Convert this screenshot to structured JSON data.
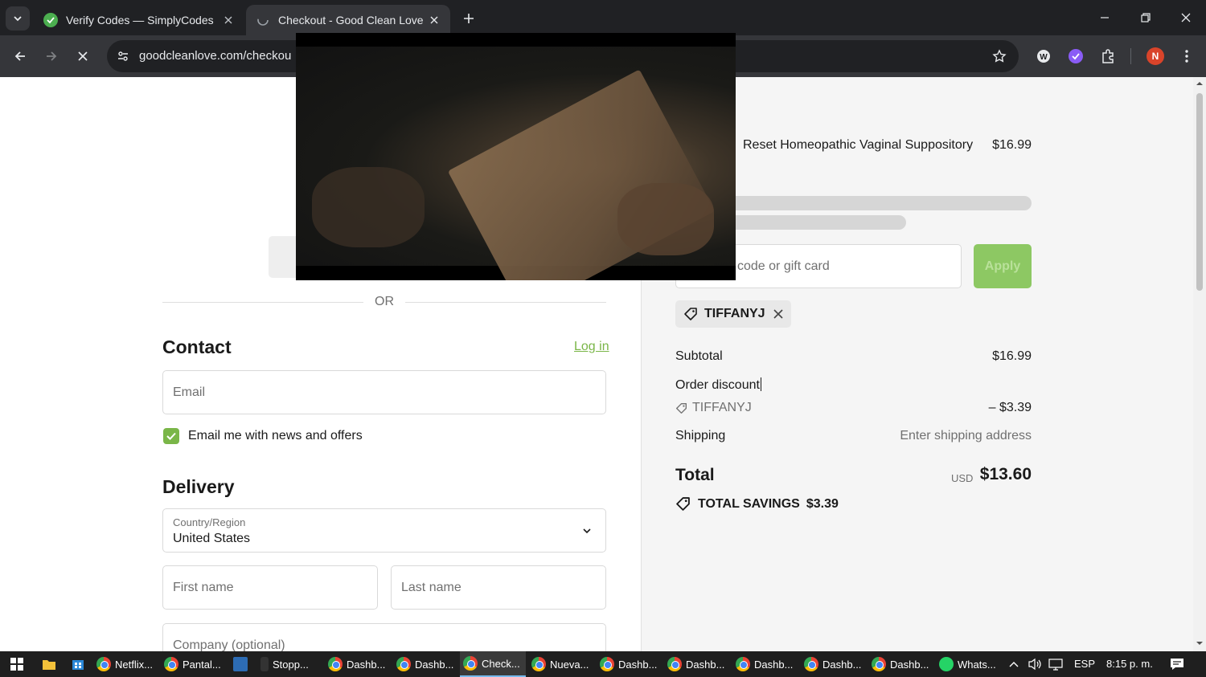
{
  "browser": {
    "tabs": [
      {
        "title": "Verify Codes — SimplyCodes",
        "active": false
      },
      {
        "title": "Checkout - Good Clean Love",
        "active": true
      }
    ],
    "url": "goodcleanlove.com/checkou",
    "profile_initial": "N"
  },
  "checkout": {
    "or_divider": "OR",
    "contact": {
      "heading": "Contact",
      "login_link": "Log in",
      "email_placeholder": "Email",
      "newsletter_label": "Email me with news and offers",
      "newsletter_checked": true
    },
    "delivery": {
      "heading": "Delivery",
      "country_label": "Country/Region",
      "country_value": "United States",
      "first_name_placeholder": "First name",
      "last_name_placeholder": "Last name",
      "company_placeholder": "Company (optional)"
    }
  },
  "summary": {
    "product_name": "Reset Homeopathic Vaginal Suppository",
    "product_price": "$16.99",
    "discount_placeholder": "code or gift card",
    "apply_label": "Apply",
    "applied_code": "TIFFANYJ",
    "subtotal_label": "Subtotal",
    "subtotal_value": "$16.99",
    "order_discount_label": "Order discount",
    "discount_code": "TIFFANYJ",
    "discount_value": "– $3.39",
    "shipping_label": "Shipping",
    "shipping_value": "Enter shipping address",
    "total_label": "Total",
    "currency": "USD",
    "total_value": "$13.60",
    "savings_label": "TOTAL SAVINGS",
    "savings_value": "$3.39"
  },
  "taskbar": {
    "items": [
      "Netflix...",
      "Pantal...",
      "Stopp...",
      "Dashb...",
      "Dashb...",
      "Check...",
      "Nueva...",
      "Dashb...",
      "Dashb...",
      "Dashb...",
      "Dashb...",
      "Dashb...",
      "Whats..."
    ],
    "language": "ESP",
    "time": "8:15 p. m."
  },
  "colors": {
    "accent_green": "#7ab648",
    "apply_button": "#8dc863",
    "browser_dark": "#202124"
  }
}
